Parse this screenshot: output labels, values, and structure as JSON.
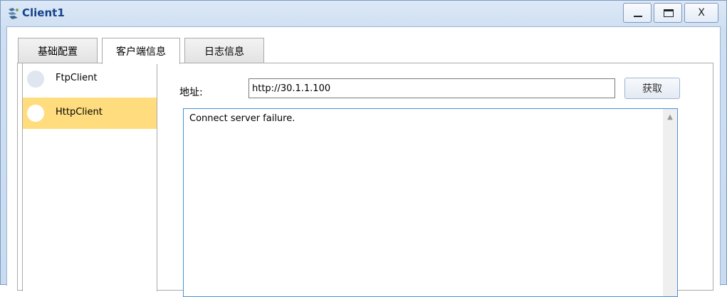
{
  "window": {
    "title": "Client1",
    "minimize_glyph": "_",
    "close_glyph": "X"
  },
  "tabs": [
    {
      "label": "基础配置",
      "active": false
    },
    {
      "label": "客户端信息",
      "active": true
    },
    {
      "label": "日志信息",
      "active": false
    }
  ],
  "client_list": {
    "items": [
      {
        "label": "FtpClient",
        "selected": false
      },
      {
        "label": "HttpClient",
        "selected": true
      }
    ]
  },
  "http": {
    "address_label": "地址:",
    "address_value": "http://30.1.1.100",
    "fetch_button_label": "获取",
    "output_text": "Connect server failure."
  },
  "colors": {
    "title_text": "#15428b",
    "selected_item": "#ffdd7e",
    "output_border": "#4a90d9"
  }
}
